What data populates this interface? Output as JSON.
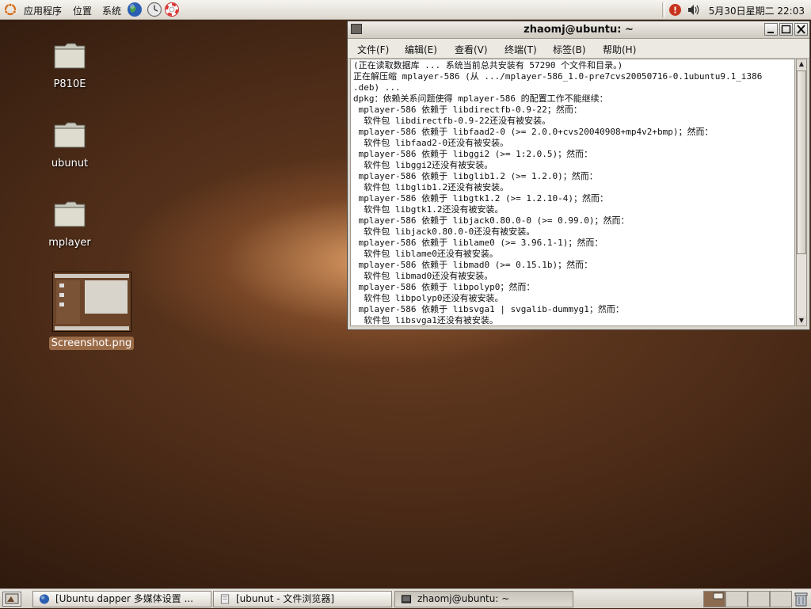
{
  "top_panel": {
    "menus": [
      "应用程序",
      "位置",
      "系统"
    ],
    "clock": "5月30日星期二 22:03",
    "launcher_icons": [
      "web-browser-icon",
      "clock-settings-icon",
      "help-lifebuoy-icon"
    ],
    "tray_icons": [
      "update-notifier-icon",
      "volume-icon"
    ]
  },
  "desktop": {
    "icons": [
      {
        "label": "P810E",
        "type": "folder"
      },
      {
        "label": "ubunut",
        "type": "folder"
      },
      {
        "label": "mplayer",
        "type": "folder"
      },
      {
        "label": "Screenshot.png",
        "type": "image",
        "selected": true
      }
    ]
  },
  "terminal": {
    "title": "zhaomj@ubuntu: ~",
    "menus": [
      "文件(F)",
      "编辑(E)",
      "查看(V)",
      "终端(T)",
      "标签(B)",
      "帮助(H)"
    ],
    "lines": [
      "(正在读取数据库 ... 系统当前总共安装有 57290 个文件和目录。)",
      "正在解压缩 mplayer-586 (从 .../mplayer-586_1.0-pre7cvs20050716-0.1ubuntu9.1_i386",
      ".deb) ...",
      "dpkg：依赖关系问题使得 mplayer-586 的配置工作不能继续：",
      " mplayer-586 依赖于 libdirectfb-0.9-22；然而：",
      "  软件包 libdirectfb-0.9-22还没有被安装。",
      " mplayer-586 依赖于 libfaad2-0 (>= 2.0.0+cvs20040908+mp4v2+bmp)；然而：",
      "  软件包 libfaad2-0还没有被安装。",
      " mplayer-586 依赖于 libggi2 (>= 1:2.0.5)；然而：",
      "  软件包 libggi2还没有被安装。",
      " mplayer-586 依赖于 libglib1.2 (>= 1.2.0)；然而：",
      "  软件包 libglib1.2还没有被安装。",
      " mplayer-586 依赖于 libgtk1.2 (>= 1.2.10-4)；然而：",
      "  软件包 libgtk1.2还没有被安装。",
      " mplayer-586 依赖于 libjack0.80.0-0 (>= 0.99.0)；然而：",
      "  软件包 libjack0.80.0-0还没有被安装。",
      " mplayer-586 依赖于 liblame0 (>= 3.96.1-1)；然而：",
      "  软件包 liblame0还没有被安装。",
      " mplayer-586 依赖于 libmad0 (>= 0.15.1b)；然而：",
      "  软件包 libmad0还没有被安装。",
      " mplayer-586 依赖于 libpolyp0；然而：",
      "  软件包 libpolyp0还没有被安装。",
      " mplayer-586 依赖于 libsvga1 | svgalib-dummyg1；然而：",
      "  软件包 libsvga1还没有被安装。"
    ],
    "buttons": [
      "minimize-button",
      "maximize-button",
      "close-button"
    ]
  },
  "taskbar": {
    "tasks": [
      {
        "label": "[Ubuntu dapper 多媒体设置 ...",
        "icon": "globe-icon",
        "active": false
      },
      {
        "label": "[ubunut - 文件浏览器]",
        "icon": "file-manager-icon",
        "active": false
      },
      {
        "label": "zhaomj@ubuntu: ~",
        "icon": "terminal-icon",
        "active": true
      }
    ],
    "workspaces": 4,
    "active_workspace": 1
  },
  "colors": {
    "desktop_brown": "#4a2a17",
    "desktop_glow": "#eeaa6e",
    "panel": "#e4e0d8",
    "selection": "#9a6a47"
  }
}
